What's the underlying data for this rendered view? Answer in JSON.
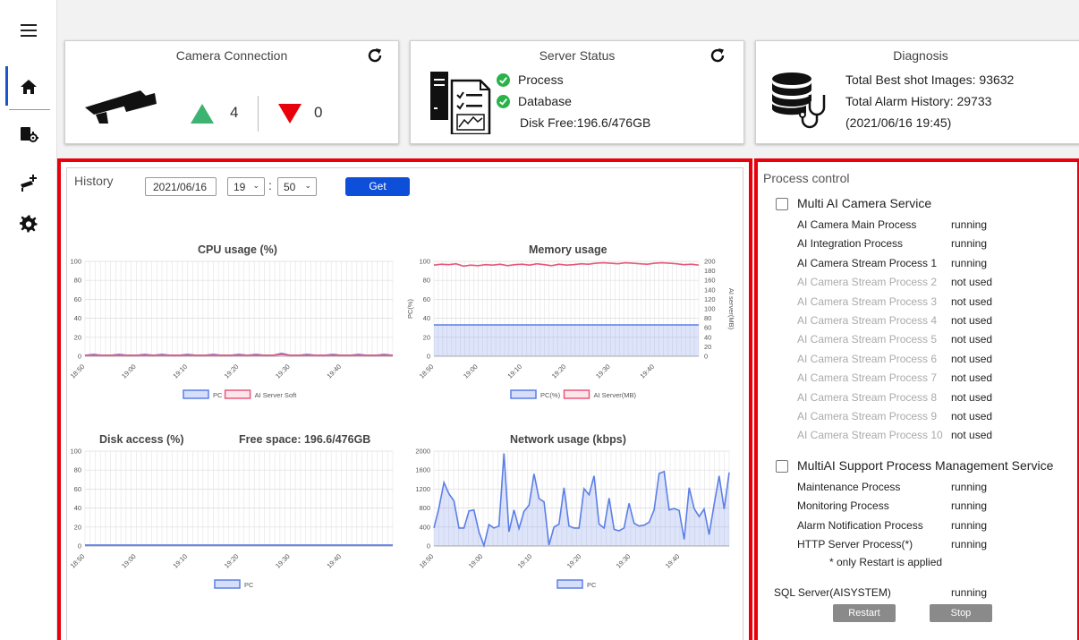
{
  "sidebar": {
    "items": [
      {
        "name": "menu-icon"
      },
      {
        "name": "home-icon"
      },
      {
        "name": "camera-settings-icon"
      },
      {
        "name": "add-camera-icon"
      },
      {
        "name": "gear-icon"
      }
    ]
  },
  "camera_connection": {
    "title": "Camera Connection",
    "up_count": "4",
    "down_count": "0",
    "up_color": "#3cb371",
    "down_color": "#e8000b"
  },
  "server_status": {
    "title": "Server Status",
    "process_label": "Process",
    "database_label": "Database",
    "disk_free": "Disk Free:196.6/476GB",
    "ok_color": "#2ab24a"
  },
  "diagnosis": {
    "title": "Diagnosis",
    "best_shot": "Total Best shot Images: 93632",
    "alarm_history": "Total Alarm History: 29733",
    "timestamp": "(2021/06/16 19:45)"
  },
  "history": {
    "label": "History",
    "date_value": "2021/06/16",
    "hour_value": "19",
    "minute_value": "50",
    "separator": ":",
    "get_label": "Get"
  },
  "charts": {
    "cpu_title": "CPU usage (%)",
    "memory_title": "Memory usage",
    "disk_title": "Disk access (%)",
    "free_space": "Free space: 196.6/476GB",
    "network_title": "Network usage (kbps)"
  },
  "chart_data": [
    {
      "type": "line",
      "title": "CPU usage (%)",
      "x": [
        "18:50",
        "19:00",
        "19:10",
        "19:20",
        "19:30",
        "19:40"
      ],
      "ylim": [
        0,
        100
      ],
      "yticks": [
        0,
        20,
        40,
        60,
        80,
        100
      ],
      "grid": true,
      "legend": "bottom",
      "series": [
        {
          "name": "PC",
          "color": "#5b7fe8",
          "values": [
            1,
            2,
            1,
            1,
            2,
            1,
            1,
            2,
            1,
            2,
            1,
            1,
            2,
            1,
            1,
            2,
            1,
            1,
            2,
            1,
            2,
            1,
            1,
            3,
            1,
            1,
            2,
            1,
            1,
            2,
            1,
            1,
            2,
            1,
            1,
            2,
            1
          ]
        },
        {
          "name": "AI Server Soft",
          "color": "#e8587a",
          "values": [
            1,
            1,
            1,
            1,
            1,
            1,
            1,
            1,
            1,
            1,
            1,
            1,
            1,
            1,
            1,
            1,
            1,
            1,
            1,
            1,
            1,
            1,
            1,
            2,
            1,
            1,
            1,
            1,
            1,
            1,
            1,
            1,
            1,
            1,
            1,
            1,
            1
          ]
        }
      ]
    },
    {
      "type": "area",
      "title": "Memory usage",
      "x": [
        "18:50",
        "19:00",
        "19:10",
        "19:20",
        "19:30",
        "19:40"
      ],
      "ylabel": "PC(%)",
      "ylabel_right": "AI server(MB)",
      "ylim": [
        0,
        100
      ],
      "yticks": [
        0,
        20,
        40,
        60,
        80,
        100
      ],
      "ylim_right": [
        0,
        200
      ],
      "yticks_right": [
        0,
        20,
        40,
        60,
        80,
        100,
        120,
        140,
        160,
        180,
        200
      ],
      "grid": true,
      "legend": "bottom",
      "series": [
        {
          "name": "PC(%)",
          "color": "#5b7fe8",
          "values": [
            33,
            33,
            33,
            33,
            33,
            33,
            33,
            33,
            33,
            33,
            33,
            33,
            33,
            33,
            33,
            33,
            33,
            33,
            33,
            33,
            33,
            33,
            33,
            33,
            33,
            33,
            33,
            33,
            33,
            33,
            33,
            33,
            33,
            33,
            33,
            33,
            33
          ]
        },
        {
          "name": "AI Server(MB)",
          "color": "#e8587a",
          "axis": "right",
          "values": [
            192,
            194,
            193,
            195,
            190,
            192,
            191,
            193,
            192,
            194,
            191,
            193,
            194,
            192,
            195,
            193,
            191,
            194,
            192,
            193,
            195,
            194,
            196,
            197,
            196,
            195,
            197,
            196,
            195,
            194,
            196,
            197,
            196,
            195,
            193,
            194,
            192
          ]
        }
      ]
    },
    {
      "type": "area",
      "title": "Disk access (%)",
      "x": [
        "18:50",
        "19:00",
        "19:10",
        "19:20",
        "19:30",
        "19:40"
      ],
      "ylim": [
        0,
        100
      ],
      "yticks": [
        0,
        20,
        40,
        60,
        80,
        100
      ],
      "grid": true,
      "legend": "bottom",
      "series": [
        {
          "name": "PC",
          "color": "#5b7fe8",
          "values": [
            1,
            1,
            1,
            1,
            1,
            1,
            1,
            1,
            1,
            1,
            1,
            1,
            1,
            1,
            1,
            1,
            1,
            1,
            1,
            1,
            1,
            1,
            1,
            1,
            1,
            1,
            1,
            1,
            1,
            1,
            1,
            1,
            1,
            1,
            1,
            1,
            1
          ]
        }
      ]
    },
    {
      "type": "area",
      "title": "Network usage (kbps)",
      "x": [
        "18:50",
        "19:00",
        "19:10",
        "19:20",
        "19:30",
        "19:40"
      ],
      "ylim": [
        0,
        2000
      ],
      "yticks": [
        0,
        400,
        800,
        1200,
        1600,
        2000
      ],
      "grid": true,
      "legend": "bottom",
      "series": [
        {
          "name": "PC",
          "color": "#5b7fe8",
          "values": [
            380,
            800,
            1340,
            1100,
            950,
            380,
            380,
            740,
            760,
            300,
            10,
            450,
            380,
            420,
            1950,
            300,
            760,
            370,
            730,
            860,
            1520,
            1000,
            930,
            20,
            400,
            460,
            1230,
            420,
            380,
            380,
            1210,
            1080,
            1480,
            460,
            380,
            1010,
            350,
            320,
            380,
            900,
            480,
            420,
            440,
            500,
            760,
            1530,
            1570,
            760,
            790,
            750,
            140,
            1230,
            790,
            620,
            780,
            240,
            880,
            1480,
            780,
            1550
          ]
        }
      ]
    }
  ],
  "process_control": {
    "title": "Process control",
    "services": [
      {
        "label": "Multi AI Camera Service",
        "processes": [
          {
            "name": "AI Camera Main Process",
            "status": "running",
            "dim": false
          },
          {
            "name": "AI Integration Process",
            "status": "running",
            "dim": false
          },
          {
            "name": "AI Camera Stream Process 1",
            "status": "running",
            "dim": false
          },
          {
            "name": "AI Camera Stream Process 2",
            "status": "not used",
            "dim": true
          },
          {
            "name": "AI Camera Stream Process 3",
            "status": "not used",
            "dim": true
          },
          {
            "name": "AI Camera Stream Process 4",
            "status": "not used",
            "dim": true
          },
          {
            "name": "AI Camera Stream Process 5",
            "status": "not used",
            "dim": true
          },
          {
            "name": "AI Camera Stream Process 6",
            "status": "not used",
            "dim": true
          },
          {
            "name": "AI Camera Stream Process 7",
            "status": "not used",
            "dim": true
          },
          {
            "name": "AI Camera Stream Process 8",
            "status": "not used",
            "dim": true
          },
          {
            "name": "AI Camera Stream Process 9",
            "status": "not used",
            "dim": true
          },
          {
            "name": "AI Camera Stream Process 10",
            "status": "not used",
            "dim": true
          }
        ]
      },
      {
        "label": "MultiAI Support Process Management Service",
        "processes": [
          {
            "name": "Maintenance Process",
            "status": "running",
            "dim": false
          },
          {
            "name": "Monitoring Process",
            "status": "running",
            "dim": false
          },
          {
            "name": "Alarm Notification Process",
            "status": "running",
            "dim": false
          },
          {
            "name": "HTTP Server Process(*)",
            "status": "running",
            "dim": false
          }
        ]
      }
    ],
    "note": "* only Restart is applied",
    "sql_label": "SQL Server(AISYSTEM)",
    "sql_status": "running",
    "restart_label": "Restart",
    "stop_label": "Stop"
  },
  "colors": {
    "highlight_border": "#e8000b",
    "accent": "#0d4fd9"
  }
}
